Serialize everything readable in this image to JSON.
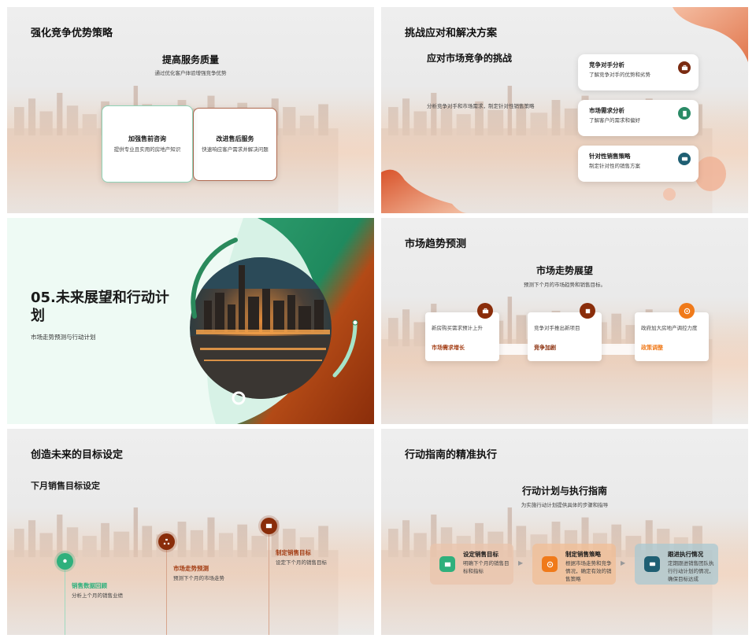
{
  "colors": {
    "green": "#2e9e6e",
    "teal": "#1f6e7e",
    "rust": "#a33d14",
    "orange": "#f07a1a",
    "brown": "#8a2d0a"
  },
  "slide1": {
    "title": "强化竞争优势策略",
    "heading": "提高服务质量",
    "subtitle": "通过优化客户体验增强竞争优势",
    "cards": [
      {
        "title": "加强售前咨询",
        "desc": "提供专业且实用的房地产知识"
      },
      {
        "title": "改进售后服务",
        "desc": "快速响应客户需求并解决问题"
      }
    ]
  },
  "slide2": {
    "title": "挑战应对和解决方案",
    "heading": "应对市场竞争的挑战",
    "desc": "分析竞争对手和市场需求，制定针对性销售策略",
    "cards": [
      {
        "title": "竞争对手分析",
        "desc": "了解竞争对手的优势和劣势",
        "icon": "briefcase-icon"
      },
      {
        "title": "市场需求分析",
        "desc": "了解客户的需求和偏好",
        "icon": "document-icon"
      },
      {
        "title": "针对性销售策略",
        "desc": "制定针对性的销售方案",
        "icon": "chat-icon"
      }
    ]
  },
  "slide3": {
    "title": "05.未来展望和行动计划",
    "subtitle": "市场走势预测与行动计划"
  },
  "slide4": {
    "title": "市场趋势预测",
    "heading": "市场走势展望",
    "subtitle": "预测下个月的市场趋势和销售目标。",
    "cards": [
      {
        "desc": "新房购买需求预计上升",
        "label": "市场需求增长",
        "icon": "briefcase-icon"
      },
      {
        "desc": "竞争对手推出新项目",
        "label": "竞争加剧",
        "icon": "puzzle-icon"
      },
      {
        "desc": "政府加大房地产调控力度",
        "label": "政策调整",
        "icon": "target-icon"
      }
    ]
  },
  "slide5": {
    "title": "创造未来的目标设定",
    "heading": "下月销售目标设定",
    "items": [
      {
        "label": "销售数据回顾",
        "desc": "分析上个月的销售业绩",
        "icon": "location-icon"
      },
      {
        "label": "市场走势预测",
        "desc": "预测下个月的市场走势",
        "icon": "sitemap-icon"
      },
      {
        "label": "制定销售目标",
        "desc": "设定下个月的销售目标",
        "icon": "image-icon"
      }
    ]
  },
  "slide6": {
    "title": "行动指南的精准执行",
    "heading": "行动计划与执行指南",
    "subtitle": "为实施行动计划提供具体的步骤和指导",
    "steps": [
      {
        "title": "设定销售目标",
        "desc": "明确下个月的销售目标和指标",
        "icon": "image-icon"
      },
      {
        "title": "制定销售策略",
        "desc": "根据市场走势和竞争情况，确定有效的销售策略",
        "icon": "target-icon"
      },
      {
        "title": "跟进执行情况",
        "desc": "定期跟进销售团队执行行动计划的情况，确保目标达成",
        "icon": "chat-icon"
      }
    ]
  }
}
